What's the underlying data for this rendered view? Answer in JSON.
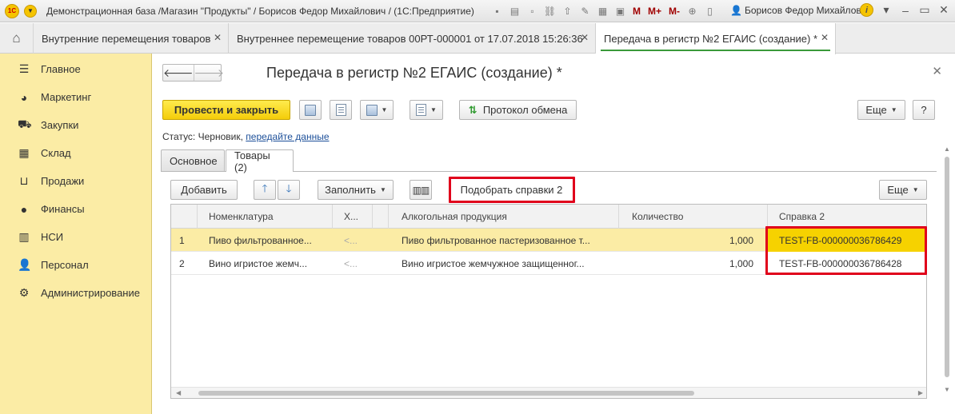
{
  "window": {
    "title": "Демонстрационная база /Магазин \"Продукты\" / Борисов Федор Михайлович /  (1С:Предприятие)",
    "m_labels": [
      "M",
      "M+",
      "M-"
    ],
    "user": "Борисов Федор Михайлович"
  },
  "tabs": [
    {
      "label": "Внутренние перемещения товаров"
    },
    {
      "label": "Внутреннее перемещение товаров 00РТ-000001 от 17.07.2018 15:26:36"
    },
    {
      "label": "Передача в регистр №2 ЕГАИС (создание) *"
    }
  ],
  "sidebar": {
    "items": [
      {
        "label": "Главное"
      },
      {
        "label": "Маркетинг"
      },
      {
        "label": "Закупки"
      },
      {
        "label": "Склад"
      },
      {
        "label": "Продажи"
      },
      {
        "label": "Финансы"
      },
      {
        "label": "НСИ"
      },
      {
        "label": "Персонал"
      },
      {
        "label": "Администрирование"
      }
    ]
  },
  "form": {
    "title": "Передача в регистр №2 ЕГАИС (создание) *",
    "toolbar": {
      "post_close": "Провести и закрыть",
      "exchange_log": "Протокол обмена",
      "more": "Еще",
      "help": "?"
    },
    "status": {
      "label": "Статус:",
      "value": "Черновик,",
      "link": "передайте данные"
    },
    "inner_tabs": [
      {
        "label": "Основное"
      },
      {
        "label": "Товары (2)"
      }
    ],
    "goods_toolbar": {
      "add": "Добавить",
      "fill": "Заполнить",
      "pick_certificates": "Подобрать справки 2",
      "more": "Еще"
    }
  },
  "table": {
    "columns": [
      "",
      "Номенклатура",
      "Х...",
      "",
      "Алкогольная продукция",
      "Количество",
      "Справка 2"
    ],
    "rows": [
      {
        "n": "1",
        "item": "Пиво фильтрованное...",
        "char": "<...",
        "alc": "Пиво фильтрованное пастеризованное т...",
        "qty": "1,000",
        "cert": "TEST-FB-000000036786429"
      },
      {
        "n": "2",
        "item": "Вино игристое жемч...",
        "char": "<...",
        "alc": "Вино игристое жемчужное защищенног...",
        "qty": "1,000",
        "cert": "TEST-FB-000000036786428"
      }
    ]
  },
  "colors": {
    "sidebar_bg": "#fbeca5",
    "primary_button": "#f4cd0a",
    "highlight_frame": "#e0001b",
    "selected_cell": "#f6d200",
    "active_tab_underline": "#3a9a3a",
    "link": "#1c4f99"
  }
}
